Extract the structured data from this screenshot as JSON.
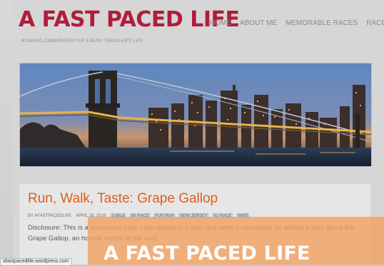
{
  "header": {
    "site_title": "A FAST PACED LIFE",
    "tagline": "RUNNING COMMENTARY OF A BUSY TRAVELER'S LIFE",
    "nav": [
      "HOME",
      "ABOUT ME",
      "MEMORABLE RACES",
      "RACE RE"
    ]
  },
  "post": {
    "title": "Run, Walk, Taste: Grape Gallop",
    "author": "BY AFASTPACEDLIFE",
    "date": "APRIL 26, 2016",
    "tags": [
      "5 MILE",
      "5K RACE",
      "FUN RUN",
      "NEW JERSEY",
      "NJ RACE",
      "WINE"
    ],
    "excerpt": "Disclosure: This is a sponsored post. I am receiving a free race entry in exchange for writing a post about the Grape Gallop, an honest review of the race."
  },
  "status_url": "afastpacedlife.wordpress.com",
  "overlay_title": "A FAST PACED LIFE",
  "colors": {
    "title": "#b01d3a",
    "post_title": "#e05d1e",
    "overlay": "#f1a163",
    "tag_bg": "#c7d8e6"
  }
}
